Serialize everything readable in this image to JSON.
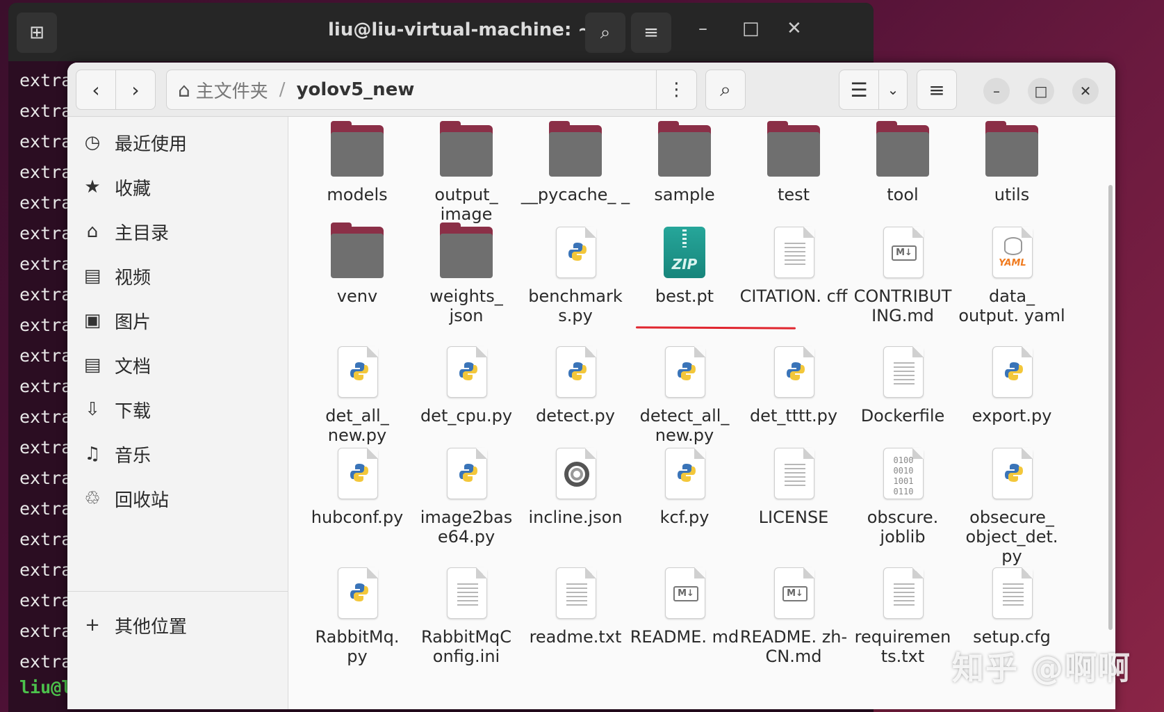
{
  "terminal": {
    "title": "liu@liu-virtual-machine: ~",
    "lines": [
      "extra",
      "extra",
      "extra",
      "extra",
      "extra",
      "extra",
      "extra",
      "extra",
      "extra",
      "extra",
      "extra",
      "extra",
      "extra",
      "extra",
      "extra",
      "extra",
      "extra",
      "extra",
      "extra",
      "extra"
    ],
    "prompt": "liu@li"
  },
  "files": {
    "path_home": "主文件夹",
    "path_sep": "/",
    "path_current": "yolov5_new",
    "sidebar": [
      {
        "label": "最近使用",
        "icon": "clock-icon"
      },
      {
        "label": "收藏",
        "icon": "star-icon"
      },
      {
        "label": "主目录",
        "icon": "home-icon"
      },
      {
        "label": "视频",
        "icon": "video-icon"
      },
      {
        "label": "图片",
        "icon": "image-icon"
      },
      {
        "label": "文档",
        "icon": "document-icon"
      },
      {
        "label": "下载",
        "icon": "download-icon"
      },
      {
        "label": "音乐",
        "icon": "music-icon"
      },
      {
        "label": "回收站",
        "icon": "trash-icon"
      }
    ],
    "other_locations": "其他位置",
    "items": [
      {
        "name": "models",
        "type": "folder"
      },
      {
        "name": "output_ image",
        "type": "folder"
      },
      {
        "name": "__pycache_ _",
        "type": "folder"
      },
      {
        "name": "sample",
        "type": "folder"
      },
      {
        "name": "test",
        "type": "folder"
      },
      {
        "name": "tool",
        "type": "folder"
      },
      {
        "name": "utils",
        "type": "folder"
      },
      {
        "name": "venv",
        "type": "folder"
      },
      {
        "name": "weights_ json",
        "type": "folder"
      },
      {
        "name": "benchmark s.py",
        "type": "python"
      },
      {
        "name": "best.pt",
        "type": "zip"
      },
      {
        "name": "CITATION. cff",
        "type": "text"
      },
      {
        "name": "CONTRIBUT ING.md",
        "type": "markdown"
      },
      {
        "name": "data_ output. yaml",
        "type": "yaml"
      },
      {
        "name": "det_all_ new.py",
        "type": "python"
      },
      {
        "name": "det_cpu.py",
        "type": "python"
      },
      {
        "name": "detect.py",
        "type": "python"
      },
      {
        "name": "detect_all_ new.py",
        "type": "python"
      },
      {
        "name": "det_tttt.py",
        "type": "python"
      },
      {
        "name": "Dockerfile",
        "type": "text"
      },
      {
        "name": "export.py",
        "type": "python"
      },
      {
        "name": "hubconf.py",
        "type": "python"
      },
      {
        "name": "image2bas e64.py",
        "type": "python"
      },
      {
        "name": "incline.json",
        "type": "json"
      },
      {
        "name": "kcf.py",
        "type": "python"
      },
      {
        "name": "LICENSE",
        "type": "text"
      },
      {
        "name": "obscure. joblib",
        "type": "binary"
      },
      {
        "name": "obsecure_ object_det. py",
        "type": "python"
      },
      {
        "name": "RabbitMq. py",
        "type": "python"
      },
      {
        "name": "RabbitMqC onfig.ini",
        "type": "text"
      },
      {
        "name": "readme.txt",
        "type": "text"
      },
      {
        "name": "README. md",
        "type": "markdown"
      },
      {
        "name": "README. zh-CN.md",
        "type": "markdown"
      },
      {
        "name": "requiremen ts.txt",
        "type": "text"
      },
      {
        "name": "setup.cfg",
        "type": "text"
      }
    ]
  },
  "watermark": "知乎 @啊啊",
  "colors": {
    "folder_tab": "#8b2f47",
    "folder_body": "#6f6f6f",
    "annotation_underline": "#e0262f",
    "zip_icon": "#26a69a"
  }
}
